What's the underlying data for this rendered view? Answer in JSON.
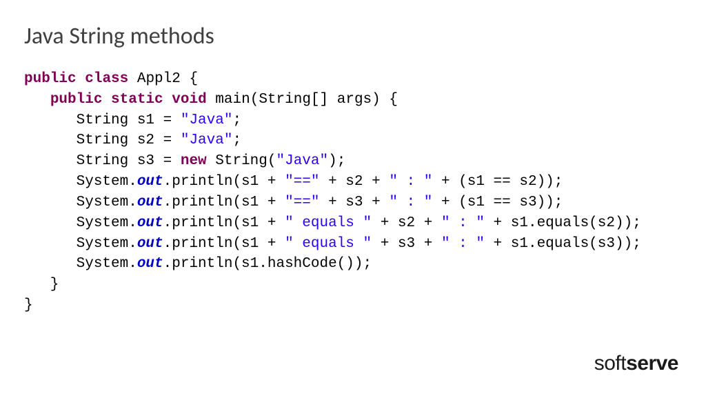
{
  "title": "Java String methods",
  "code": {
    "l1a": "public",
    "l1b": "class",
    "l1c": " Appl2 {",
    "l2a": "public",
    "l2b": "static",
    "l2c": "void",
    "l2d": " main(String[] args) {",
    "l3a": "      String s1 = ",
    "l3b": "\"Java\"",
    "l3c": ";",
    "l4a": "      String s2 = ",
    "l4b": "\"Java\"",
    "l4c": ";",
    "l5a": "      String s3 = ",
    "l5b": "new",
    "l5c": " String(",
    "l5d": "\"Java\"",
    "l5e": ");",
    "l6a": "      System.",
    "l6b": "out",
    "l6c": ".println(s1 + ",
    "l6d": "\"==\"",
    "l6e": " + s2 + ",
    "l6f": "\" : \"",
    "l6g": " + (s1 == s2));",
    "l7a": "      System.",
    "l7b": "out",
    "l7c": ".println(s1 + ",
    "l7d": "\"==\"",
    "l7e": " + s3 + ",
    "l7f": "\" : \"",
    "l7g": " + (s1 == s3));",
    "l8a": "      System.",
    "l8b": "out",
    "l8c": ".println(s1 + ",
    "l8d": "\" equals \"",
    "l8e": " + s2 + ",
    "l8f": "\" : \"",
    "l8g": " + s1.equals(s2));",
    "l9a": "      System.",
    "l9b": "out",
    "l9c": ".println(s1 + ",
    "l9d": "\" equals \"",
    "l9e": " + s3 + ",
    "l9f": "\" : \"",
    "l9g": " + s1.equals(s3));",
    "l10a": "      System.",
    "l10b": "out",
    "l10c": ".println(s1.hashCode());",
    "l11": "   }",
    "l12": "}"
  },
  "logo": {
    "soft": "soft",
    "serve": "serve"
  }
}
